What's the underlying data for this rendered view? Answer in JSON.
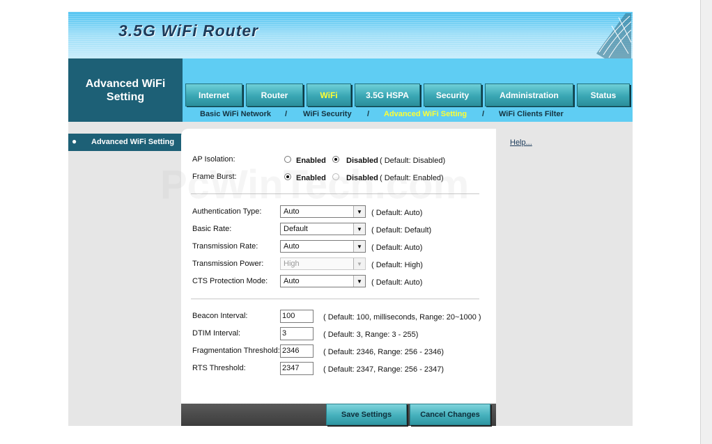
{
  "header": {
    "title": "3.5G WiFi Router"
  },
  "section_title": "Advanced WiFi Setting",
  "nav": {
    "tabs": [
      {
        "label": "Internet"
      },
      {
        "label": "Router"
      },
      {
        "label": "WiFi",
        "active": true
      },
      {
        "label": "3.5G HSPA"
      },
      {
        "label": "Security"
      },
      {
        "label": "Administration"
      },
      {
        "label": "Status"
      }
    ],
    "subtabs": [
      {
        "label": "Basic WiFi Network"
      },
      {
        "label": "WiFi Security"
      },
      {
        "label": "Advanced WiFi Setting",
        "active": true
      },
      {
        "label": "WiFi Clients Filter"
      }
    ],
    "separator": "/"
  },
  "sidebar": {
    "items": [
      {
        "bullet": "●",
        "label": "Advanced WiFi Setting"
      }
    ]
  },
  "help": {
    "label": "Help..."
  },
  "watermark": "PcWinTech.com",
  "form": {
    "ap_isolation": {
      "label": "AP Isolation:",
      "enabled": "Enabled",
      "disabled": "Disabled",
      "default": "( Default: Disabled)",
      "selected": "Disabled"
    },
    "frame_burst": {
      "label": "Frame Burst:",
      "enabled": "Enabled",
      "disabled": "Disabled",
      "default": "( Default: Enabled)",
      "selected": "Enabled"
    },
    "auth_type": {
      "label": "Authentication Type:",
      "value": "Auto",
      "default": "( Default: Auto)"
    },
    "basic_rate": {
      "label": "Basic Rate:",
      "value": "Default",
      "default": "( Default: Default)"
    },
    "tx_rate": {
      "label": "Transmission Rate:",
      "value": "Auto",
      "default": "( Default: Auto)"
    },
    "tx_power": {
      "label": "Transmission Power:",
      "value": "High",
      "default": "( Default: High)"
    },
    "cts_mode": {
      "label": "CTS Protection Mode:",
      "value": "Auto",
      "default": "( Default: Auto)"
    },
    "beacon": {
      "label": "Beacon Interval:",
      "value": "100",
      "default": "( Default: 100, milliseconds, Range: 20~1000 )"
    },
    "dtim": {
      "label": "DTIM Interval:",
      "value": "3",
      "default": "( Default: 3, Range: 3 - 255)"
    },
    "frag": {
      "label": "Fragmentation Threshold:",
      "value": "2346",
      "default": "( Default: 2346, Range: 256 - 2346)"
    },
    "rts": {
      "label": "RTS Threshold:",
      "value": "2347",
      "default": "( Default: 2347, Range: 256 - 2347)"
    }
  },
  "buttons": {
    "save": "Save Settings",
    "cancel": "Cancel Changes"
  },
  "colors": {
    "banner": "#4fc3f1",
    "nav": "#5fcdf3",
    "sidebar": "#1d6076",
    "active_tab": "#ffff33",
    "panel": "#e6e6e6"
  }
}
